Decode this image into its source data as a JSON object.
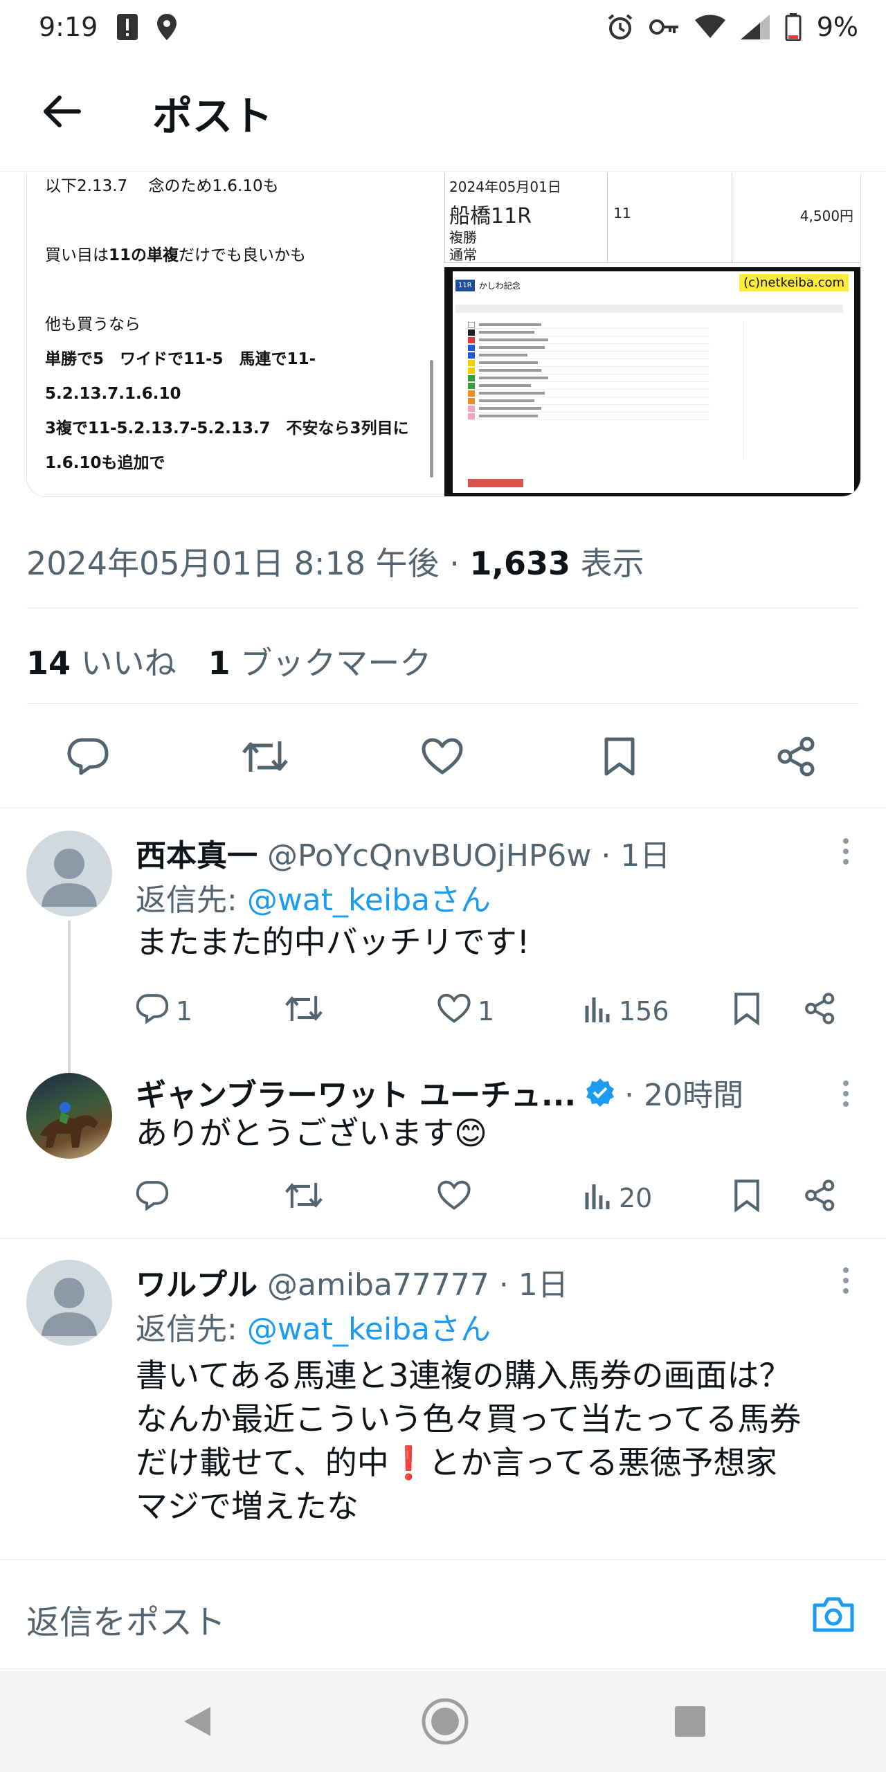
{
  "status_bar": {
    "time": "9:19",
    "battery": "9%",
    "icons": [
      "alert-icon",
      "location-icon",
      "alarm-icon",
      "key-icon",
      "wifi-icon",
      "signal-icon",
      "battery-icon"
    ]
  },
  "header": {
    "title": "ポスト",
    "back_icon": "arrow-left-icon"
  },
  "media": {
    "left_lines": [
      {
        "text": "以下2.13.7　 念のため1.6.10も",
        "bold": false
      },
      {
        "text": "買い目は11の単複だけでも良いかも",
        "bold": false,
        "partial_bold": "11の単複"
      },
      {
        "text": "他も買うなら",
        "bold": false
      },
      {
        "text": "単勝で5　ワイドで11-5　馬連で11-",
        "bold": true
      },
      {
        "text": "5.2.13.7.1.6.10",
        "bold": true
      },
      {
        "text": "3複で11-5.2.13.7-5.2.13.7　不安なら3列目に",
        "bold": true
      },
      {
        "text": "1.6.10も追加で",
        "bold": true
      }
    ],
    "race_ticket": {
      "date": "2024年05月01日",
      "race": "船橋11R",
      "type": "複勝",
      "mode": "通常",
      "number": "11",
      "amount": "4,500円"
    },
    "race_shot": {
      "title": "かしわ記念",
      "logo": "(c)netkeiba.com"
    }
  },
  "meta": {
    "datetime": "2024年05月01日 8:18 午後 · ",
    "views_count": "1,633",
    "views_label": " 表示"
  },
  "stats": {
    "likes_count": "14",
    "likes_label": " いいね　",
    "bookmarks_count": "1",
    "bookmarks_label": " ブックマーク"
  },
  "actions": [
    "reply-icon",
    "retweet-icon",
    "like-icon",
    "bookmark-icon",
    "share-icon"
  ],
  "replies": [
    {
      "name": "西本真一",
      "handle": "@PoYcQnvBUOjHP6w · 1日",
      "replyto_prefix": "返信先: ",
      "replyto_user": "@wat_keibaさん",
      "text": "またまた的中バッチリです!",
      "reply_count": "1",
      "like_count": "1",
      "views": "156"
    },
    {
      "name": "ギャンブラーワット ユーチュ...",
      "handle": "· 20時間",
      "text": "ありがとうございます😊",
      "verified": true,
      "reply_count": "",
      "like_count": "",
      "views": "20"
    },
    {
      "name": "ワルプル",
      "handle": "@amiba77777 · 1日",
      "replyto_prefix": "返信先: ",
      "replyto_user": "@wat_keibaさん",
      "text_lines": [
        "書いてある馬連と3連複の購入馬券の画面は？",
        "なんか最近こういう色々買って当たってる馬券",
        "だけ載せて、的中❗とか言ってる悪徳予想家",
        "マジで増えたな"
      ]
    }
  ],
  "compose": {
    "placeholder": "返信をポスト",
    "camera_icon": "camera-icon"
  },
  "nav": {
    "icons": [
      "back-triangle-icon",
      "home-circle-icon",
      "recents-square-icon"
    ]
  },
  "colors": {
    "accent": "#1d9bf0",
    "muted": "#536471",
    "text": "#0f1419"
  }
}
